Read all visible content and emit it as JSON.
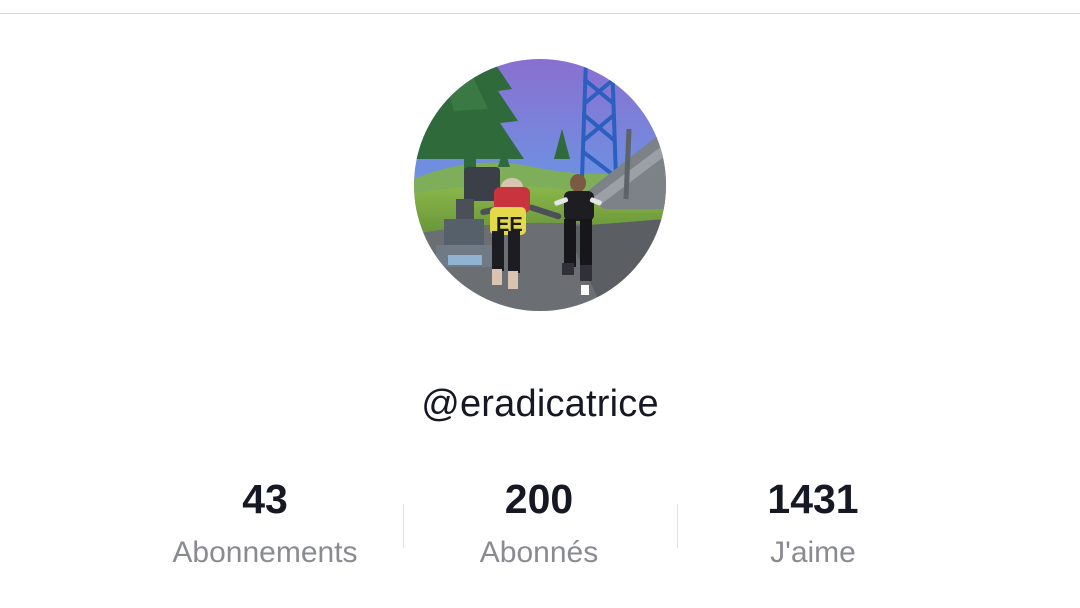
{
  "profile": {
    "username": "@eradicatrice",
    "avatar_icon": "profile-avatar-game-screenshot"
  },
  "stats": {
    "following": {
      "count": "43",
      "label": "Abonnements"
    },
    "followers": {
      "count": "200",
      "label": "Abonnés"
    },
    "likes": {
      "count": "1431",
      "label": "J'aime"
    }
  },
  "colors": {
    "primary_text": "#161823",
    "secondary_text": "#8a8b91",
    "divider": "#d9d9d9"
  }
}
